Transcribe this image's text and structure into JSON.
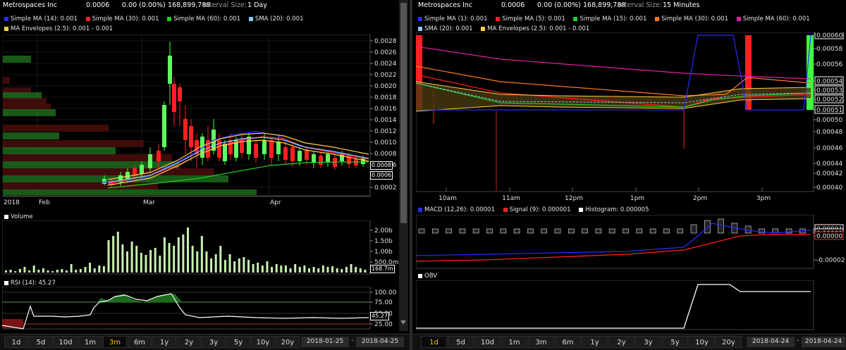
{
  "left": {
    "header": {
      "name": "Metrospaces Inc",
      "price": "0.0006",
      "change": "0.00 (0.00%)",
      "volume": "168,899,788",
      "interval_label": "Interval Size:",
      "interval": "1 Day"
    },
    "legend": [
      {
        "label": "Simple MA (14): 0.001",
        "color": "#2b2bff"
      },
      {
        "label": "Simple MA (30): 0.001",
        "color": "#ff2020"
      },
      {
        "label": "Simple MA (60): 0.001",
        "color": "#20d020"
      },
      {
        "label": "SMA (20): 0.001",
        "color": "#8ec8ff"
      },
      {
        "label": "MA Envelopes (2.5): 0.001 - 0.001",
        "color": "#ffd040"
      }
    ],
    "price_axis": [
      "0.0028",
      "0.0026",
      "0.0024",
      "0.0022",
      "0.0020",
      "0.0018",
      "0.0016",
      "0.0014",
      "0.0012",
      "0.0010",
      "0.0008",
      "0.0006",
      "0.0002"
    ],
    "price_tags": [
      "0.0008",
      "0.0006"
    ],
    "x_axis": [
      "2018",
      "Feb",
      "Mar",
      "Apr"
    ],
    "volume": {
      "title": "Volume",
      "axis": [
        "2.00b",
        "1.50b",
        "1.00b",
        "500.0m"
      ],
      "current": "168.7m"
    },
    "rsi": {
      "title": "RSI (14): 45.27",
      "axis": [
        "100.00",
        "75.00",
        "50.00",
        "25.00"
      ],
      "current": "45.27"
    },
    "ranges": [
      "1d",
      "5d",
      "10d",
      "1m",
      "3m",
      "6m",
      "1y",
      "2y",
      "3y",
      "5y",
      "10y",
      "20y"
    ],
    "active_range": "3m",
    "start_date": "2018-01-25",
    "end_date": "2018-04-25"
  },
  "right": {
    "header": {
      "name": "Metrospaces Inc",
      "price": "0.0006",
      "change": "0.00 (0.00%)",
      "volume": "168,899,788",
      "interval_label": "Interval Size:",
      "interval": "15 Minutes"
    },
    "legend_row1": [
      {
        "label": "Simple MA (1): 0.001",
        "color": "#2b2bff"
      },
      {
        "label": "Simple MA (5): 0.001",
        "color": "#ff2020"
      },
      {
        "label": "Simple MA (15): 0.001",
        "color": "#20d020"
      },
      {
        "label": "Simple MA (30): 0.001",
        "color": "#ff7a20"
      },
      {
        "label": "Simple MA (60): 0.001",
        "color": "#e020a0"
      }
    ],
    "legend_row2": [
      {
        "label": "SMA (20): 0.001",
        "color": "#8ec8ff"
      },
      {
        "label": "MA Envelopes (2.5): 0.001 - 0.001",
        "color": "#ffd040"
      }
    ],
    "price_axis": [
      "0.00060",
      "0.00058",
      "0.00056",
      "0.00054",
      "0.00053",
      "0.00052",
      "0.00051",
      "0.00050",
      "0.00048",
      "0.00046",
      "0.00044",
      "0.00042",
      "0.00040"
    ],
    "x_axis": [
      "10am",
      "11am",
      "12pm",
      "1pm",
      "2pm",
      "3pm"
    ],
    "macd": {
      "legend": [
        {
          "label": "MACD (12,26): 0.00001",
          "color": "#2b2bff"
        },
        {
          "label": "Signal (9): 0.000001",
          "color": "#ff2020"
        },
        {
          "label": "Histogram: 0.000005",
          "color": "#ffffff"
        }
      ],
      "axis": [
        "0.00001",
        "0.00001",
        "0.00000",
        "-0.00002"
      ]
    },
    "obv": {
      "title": "OBV"
    },
    "ranges": [
      "1d",
      "5d",
      "10d",
      "1m",
      "3m",
      "6m",
      "1y",
      "2y",
      "3y",
      "5y",
      "10y",
      "20y"
    ],
    "active_range": "1d",
    "start_date": "2018-04-24",
    "end_date": "2018-04-24"
  }
}
